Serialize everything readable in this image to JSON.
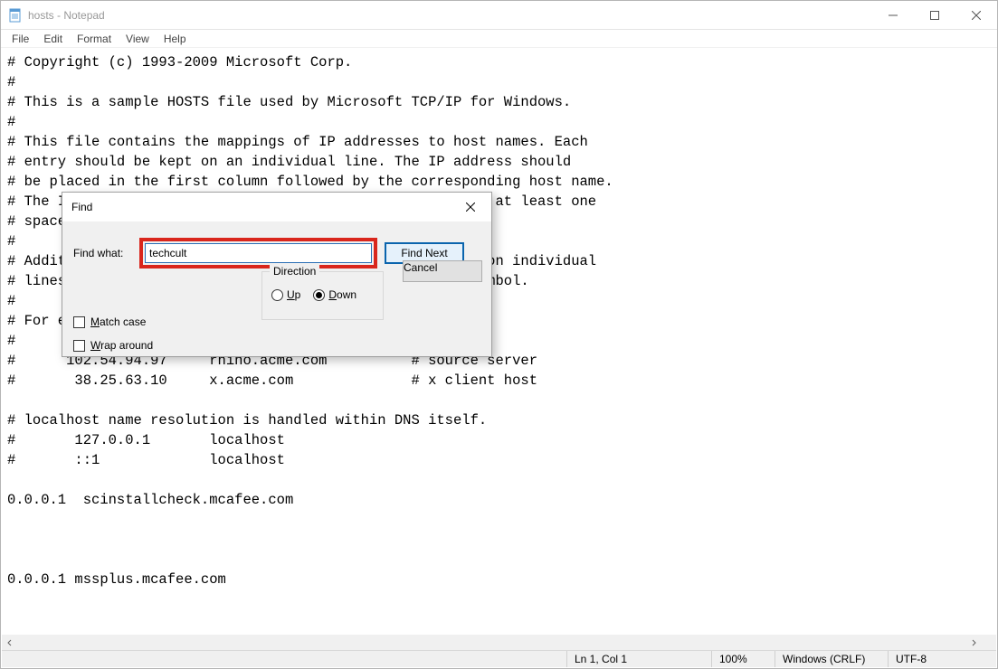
{
  "window": {
    "title": "hosts - Notepad"
  },
  "menu": {
    "file": "File",
    "edit": "Edit",
    "format": "Format",
    "view": "View",
    "help": "Help"
  },
  "editor": {
    "content": "# Copyright (c) 1993-2009 Microsoft Corp.\n#\n# This is a sample HOSTS file used by Microsoft TCP/IP for Windows.\n#\n# This file contains the mappings of IP addresses to host names. Each\n# entry should be kept on an individual line. The IP address should\n# be placed in the first column followed by the corresponding host name.\n# The IP address and the host name should be separated by at least one\n# space.\n#\n# Additionally, comments (such as these) may be inserted on individual\n# lines or following the machine name denoted by a '#' symbol.\n#\n# For example:\n#\n#      102.54.94.97     rhino.acme.com          # source server\n#       38.25.63.10     x.acme.com              # x client host\n\n# localhost name resolution is handled within DNS itself.\n#       127.0.0.1       localhost\n#       ::1             localhost\n\n0.0.0.1  scinstallcheck.mcafee.com\n\n\n\n0.0.0.1 mssplus.mcafee.com"
  },
  "statusbar": {
    "position": "Ln 1, Col 1",
    "zoom": "100%",
    "line_ending": "Windows (CRLF)",
    "encoding": "UTF-8"
  },
  "find_dialog": {
    "title": "Find",
    "find_what_label": "Find what:",
    "find_what_value": "techcult",
    "find_next": "Find Next",
    "cancel": "Cancel",
    "match_case": "Match case",
    "wrap_around": "Wrap around",
    "direction_label": "Direction",
    "up": "Up",
    "down": "Down"
  }
}
